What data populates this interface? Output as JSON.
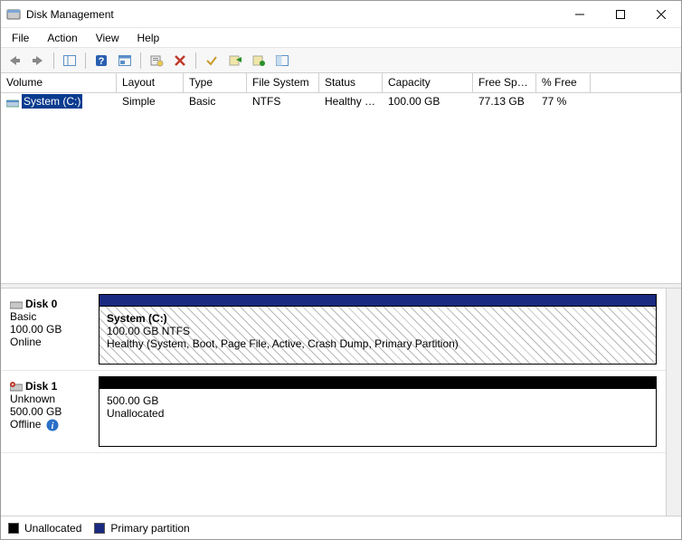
{
  "window": {
    "title": "Disk Management"
  },
  "menu": {
    "file": "File",
    "action": "Action",
    "view": "View",
    "help": "Help"
  },
  "columns": {
    "volume": "Volume",
    "layout": "Layout",
    "type": "Type",
    "fs": "File System",
    "status": "Status",
    "capacity": "Capacity",
    "free": "Free Spa...",
    "pfree": "% Free"
  },
  "volumes": [
    {
      "name": "System (C:)",
      "layout": "Simple",
      "type": "Basic",
      "fs": "NTFS",
      "status": "Healthy (S...",
      "capacity": "100.00 GB",
      "free": "77.13 GB",
      "pfree": "77 %"
    }
  ],
  "disks": [
    {
      "name": "Disk 0",
      "type": "Basic",
      "size": "100.00 GB",
      "state": "Online",
      "bar_style": "primary",
      "partition": {
        "title": "System  (C:)",
        "line2": "100.00 GB NTFS",
        "line3": "Healthy (System, Boot, Page File, Active, Crash Dump, Primary Partition)"
      }
    },
    {
      "name": "Disk 1",
      "type": "Unknown",
      "size": "500.00 GB",
      "state": "Offline",
      "bar_style": "unalloc",
      "partition": {
        "title": "",
        "line2": "500.00 GB",
        "line3": "Unallocated"
      }
    }
  ],
  "legend": {
    "unalloc": "Unallocated",
    "primary": "Primary partition"
  },
  "colors": {
    "primary": "#1a2a80",
    "unalloc": "#000000"
  }
}
